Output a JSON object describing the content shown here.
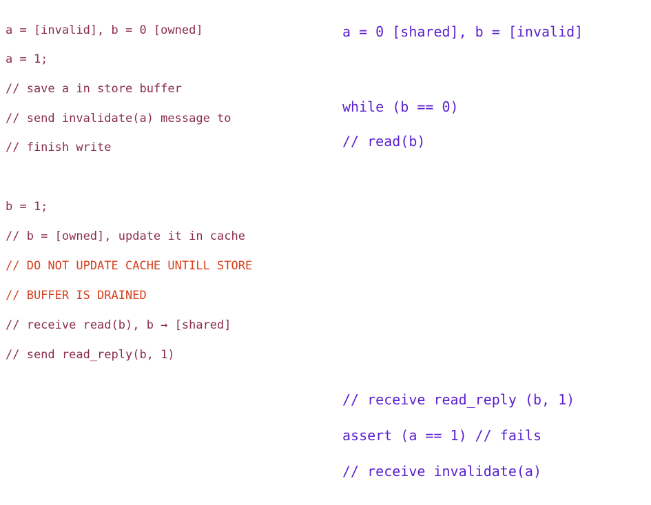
{
  "left_column": {
    "lines": [
      "a = [invalid], b = 0 [owned]",
      "a = 1;",
      "// save a in store buffer",
      "// send invalidate(a) message to",
      "// finish write",
      "b = 1;",
      "// b = [owned], update it in cache",
      "// DO NOT UPDATE CACHE UNTILL STORE",
      "// BUFFER IS DRAINED",
      "// receive read(b), b → [shared]",
      "// send read_reply(b, 1)"
    ]
  },
  "right_column": {
    "lines": [
      "a = 0 [shared], b = [invalid]",
      "while (b == 0)",
      "// read(b)",
      "// receive read_reply (b, 1)",
      "assert (a == 1) // fails",
      "// receive invalidate(a)"
    ]
  },
  "colors": {
    "left_text": "#8a2d4b",
    "warning_text": "#d6401c",
    "right_text": "#5a1fcf"
  }
}
